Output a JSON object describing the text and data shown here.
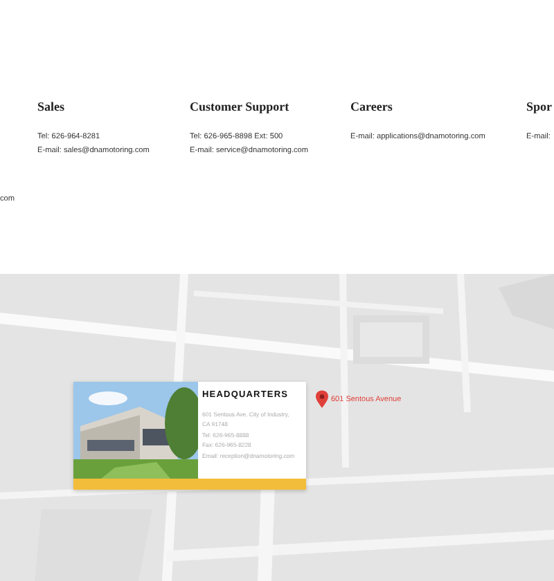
{
  "contacts": [
    {
      "heading": "Sales",
      "lines": [
        "Tel: 626-964-8281",
        "E-mail: sales@dnamotoring.com"
      ]
    },
    {
      "heading": "Customer Support",
      "lines": [
        "Tel: 626-965-8898 Ext: 500",
        "E-mail: service@dnamotoring.com"
      ]
    },
    {
      "heading": "Careers",
      "lines": [
        "E-mail: applications@dnamotoring.com"
      ]
    },
    {
      "heading": "Spor",
      "lines": [
        "E-mail:"
      ]
    }
  ],
  "cut_text": "com",
  "map": {
    "pin_label": "601 Sentous Avenue",
    "card": {
      "title": "HEADQUARTERS",
      "lines": [
        "601 Sentous Ave. City of Industry,",
        "CA 91748",
        "Tel: 626-965-8888",
        "Fax: 626-965-8228",
        "Email: reception@dnamotoring.com"
      ]
    }
  }
}
